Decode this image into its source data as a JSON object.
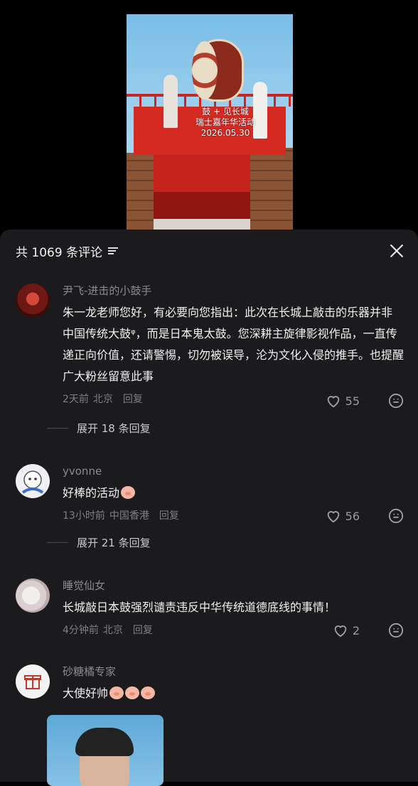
{
  "video": {
    "caption_line1": "鼓 + 见长城",
    "caption_line2": "瑞士嘉年华活动",
    "caption_date": "2026.05.30"
  },
  "header": {
    "title": "共 1069 条评论",
    "sort_icon": "sort-lines-icon",
    "close_icon": "close-icon"
  },
  "comments": [
    {
      "user": "尹飞-进击的小鼓手",
      "text": "朱一龙老师您好，有必要向您指出：此次在长城上敲击的乐器并非 中国传统大鼓ᵠ，而是日本鬼太鼓。您深耕主旋律影视作品，一直传递正向价值，还请警惕，切勿被误导，沦为文化入侵的推手。也提醒广大粉丝留意此事",
      "time": "2天前",
      "location": "北京",
      "reply_label": "回复",
      "likes": "55",
      "expand_label": "展开 18 条回复"
    },
    {
      "user": "yvonne",
      "text": "好棒的活动",
      "time": "13小时前",
      "location": "中国香港",
      "reply_label": "回复",
      "likes": "56",
      "expand_label": "展开 21 条回复"
    },
    {
      "user": "睡觉仙女",
      "text": "长城敲日本鼓强烈谴责违反中华传统道德底线的事情！",
      "time": "4分钟前",
      "location": "北京",
      "reply_label": "回复",
      "likes": "2"
    },
    {
      "user": "砂糖橘专家",
      "text": "大使好帅"
    }
  ],
  "colors": {
    "sheet_bg": "#1b1b1d",
    "username": "#8b8b8f",
    "text": "#f1f1f1",
    "meta": "#7f7f84"
  }
}
